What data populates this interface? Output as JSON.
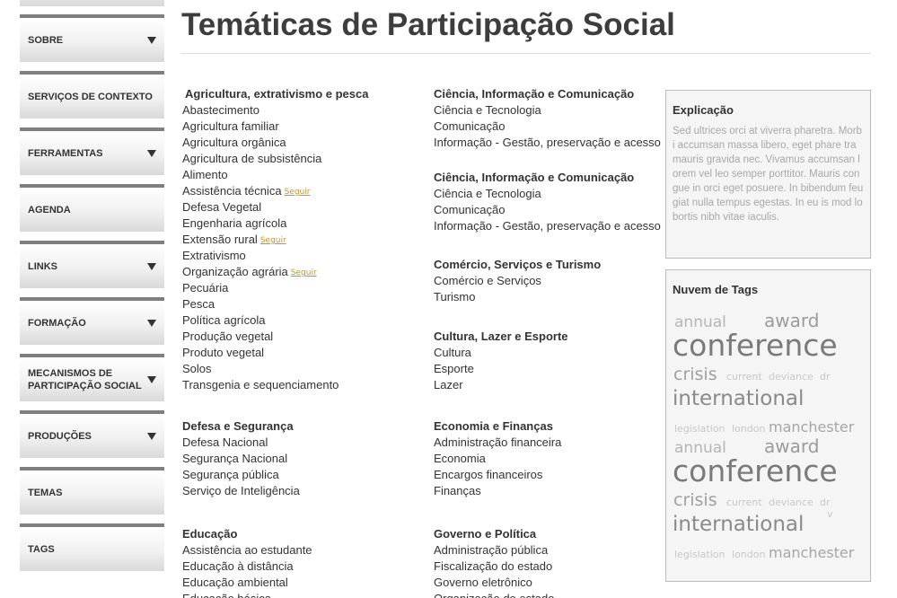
{
  "sidebar": {
    "items": [
      {
        "label": "",
        "has_arrow": false
      },
      {
        "label": "SOBRE",
        "has_arrow": true
      },
      {
        "label": "SERVIÇOS DE CONTEXTO",
        "has_arrow": false
      },
      {
        "label": "FERRAMENTAS",
        "has_arrow": true
      },
      {
        "label": "AGENDA",
        "has_arrow": false
      },
      {
        "label": "LINKS",
        "has_arrow": true
      },
      {
        "label": "FORMAÇÃO",
        "has_arrow": true
      },
      {
        "label": "MECANISMOS DE PARTICIPAÇÃO SOCIAL",
        "has_arrow": true
      },
      {
        "label": "PRODUÇÕES",
        "has_arrow": true
      },
      {
        "label": "TEMAS",
        "has_arrow": false
      },
      {
        "label": "TAGS",
        "has_arrow": false
      }
    ],
    "arrow_icon": "triangle-down-icon"
  },
  "page": {
    "title": "Temáticas de Participação Social"
  },
  "groups": {
    "agricultura": {
      "title": "Agricultura, extrativismo e pesca",
      "items": [
        "Abastecimento",
        "Agricultura familiar",
        "Agricultura orgânica",
        "Agricultura de subsistência",
        "Alimento",
        "Assistência técnica",
        "Defesa Vegetal",
        "Engenharia agrícola",
        "Extensão rural",
        "Extrativismo",
        "Organização agrária",
        "Pecuária",
        "Pesca",
        "Política agrícola",
        "Produção vegetal",
        "Produto vegetal",
        "Solos",
        "Transgenia e sequenciamento"
      ],
      "follow_label": "Seguir"
    },
    "defesa": {
      "title": "Defesa e Segurança",
      "items": [
        "Defesa Nacional",
        "Segurança Nacional",
        "Segurança pública",
        "Serviço de Inteligência"
      ]
    },
    "educacao": {
      "title": "Educação",
      "items": [
        "Assistência ao estudante",
        "Educação à distância",
        "Educação ambiental",
        "Educação básica"
      ]
    },
    "ciencia1": {
      "title": "Ciência, Informação e Comunicação",
      "items": [
        "Ciência e Tecnologia",
        "Comunicação",
        "Informação - Gestão, preservação e acesso"
      ]
    },
    "ciencia2": {
      "title": "Ciência, Informação e Comunicação",
      "items": [
        "Ciência e Tecnologia",
        "Comunicação",
        "Informação - Gestão, preservação e acesso"
      ]
    },
    "comercio": {
      "title": "Comércio, Serviços e Turismo",
      "items": [
        "Comércio e Serviços",
        "Turismo"
      ]
    },
    "cultura": {
      "title": "Cultura, Lazer e Esporte",
      "items": [
        "Cultura",
        "Esporte",
        "Lazer"
      ]
    },
    "economia": {
      "title": "Economia e Finanças",
      "items": [
        "Administração financeira",
        "Economia",
        "Encargos financeiros",
        "Finanças"
      ]
    },
    "governo": {
      "title": "Governo e Política",
      "items": [
        "Administração pública",
        "Fiscalização do estado",
        "Governo eletrônico",
        "Organização do estado"
      ]
    }
  },
  "explicacao": {
    "title": "Explicação",
    "text": "Sed ultrices orci at viverra pharetra. Morbi accumsan massa libero, eget phare tra mauris gravida nec. Vivamus accumsan lorem vel leo semper porttitor. Mauris congue in orci eget posuere. In bibendum feugiat nulla tempus egestas. In eu is mod lobortis nibh vitae iaculis."
  },
  "tag_cloud": {
    "title": "Nuvem de Tags",
    "tags": {
      "annual": "annual",
      "award": "award",
      "conference": "conference",
      "crisis": "crisis",
      "current": "current",
      "deviance": "deviance",
      "dr": "dr",
      "international": "international",
      "legislation": "legislation",
      "london": "london",
      "manchester": "manchester",
      "v": "v"
    }
  }
}
